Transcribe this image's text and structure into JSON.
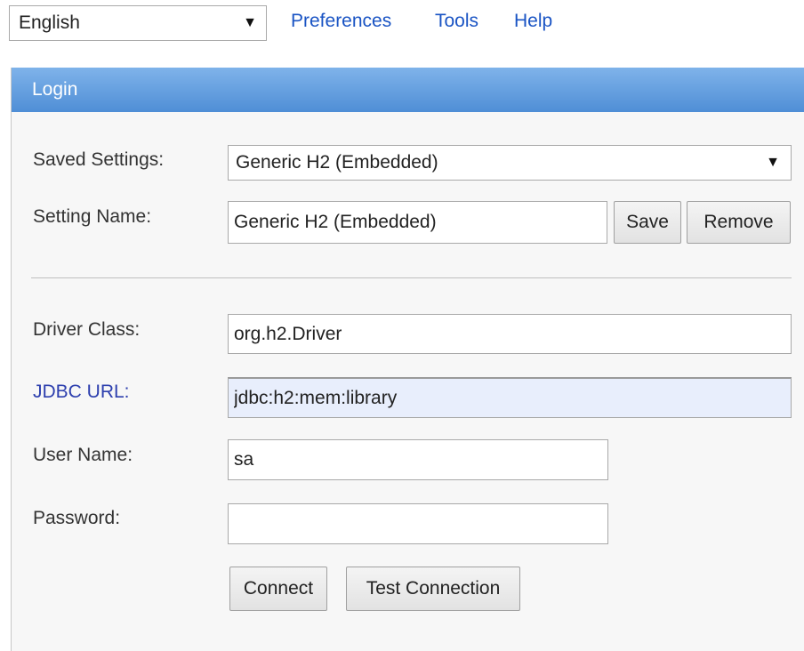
{
  "topbar": {
    "language": "English",
    "links": {
      "preferences": "Preferences",
      "tools": "Tools",
      "help": "Help"
    }
  },
  "login": {
    "title": "Login",
    "saved_settings_label": "Saved Settings:",
    "saved_settings_value": "Generic H2 (Embedded)",
    "setting_name_label": "Setting Name:",
    "setting_name_value": "Generic H2 (Embedded)",
    "save_label": "Save",
    "remove_label": "Remove",
    "driver_class_label": "Driver Class:",
    "driver_class_value": "org.h2.Driver",
    "jdbc_url_label": "JDBC URL:",
    "jdbc_url_value": "jdbc:h2:mem:library",
    "user_name_label": "User Name:",
    "user_name_value": "sa",
    "password_label": "Password:",
    "password_value": "",
    "connect_label": "Connect",
    "test_connection_label": "Test Connection"
  },
  "icons": {
    "dropdown": "chevron-down-icon"
  },
  "colors": {
    "header_top": "#7fb3ea",
    "header_bottom": "#4f8ed6",
    "link": "#1a54c4",
    "jdbc_label": "#2d3fae",
    "panel_bg": "#f7f7f7",
    "url_field_bg": "#e8eefc"
  }
}
